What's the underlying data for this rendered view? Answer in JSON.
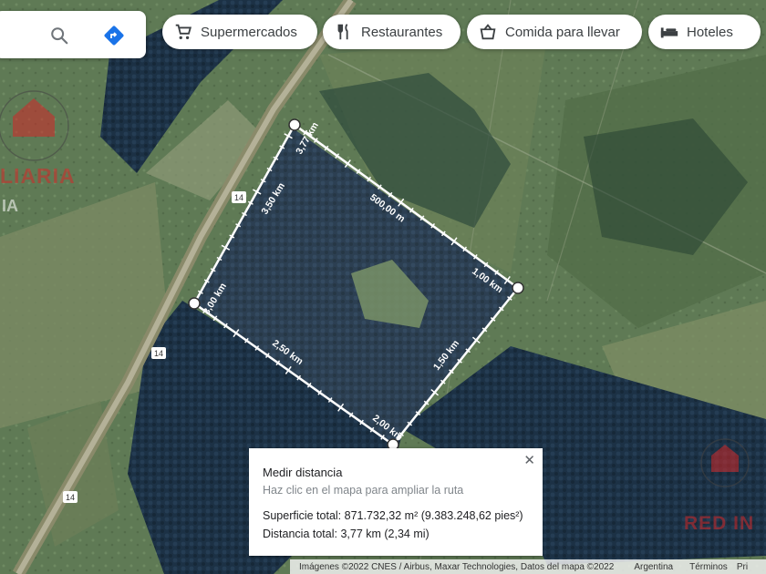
{
  "search": {
    "search_icon": "search-icon",
    "directions_icon": "directions-icon"
  },
  "chips": [
    {
      "label": "Supermercados",
      "icon": "cart-icon"
    },
    {
      "label": "Restaurantes",
      "icon": "fork-knife-icon"
    },
    {
      "label": "Comida para llevar",
      "icon": "takeout-icon"
    },
    {
      "label": "Hoteles",
      "icon": "bed-icon"
    }
  ],
  "map": {
    "road_labels": [
      "14",
      "14",
      "14"
    ],
    "measure_labels": [
      "3,77 km",
      "3,50 km",
      "500,00 m",
      "1,00 km",
      "3,00 km",
      "2,50 km",
      "1,50 km",
      "2,00 km"
    ]
  },
  "panel": {
    "title": "Medir distancia",
    "hint": "Haz clic en el mapa para ampliar la ruta",
    "area": "Superficie total: 871.732,32 m² (9.383.248,62 pies²)",
    "distance": "Distancia total: 3,77 km (2,34 mi)",
    "close_icon": "close-icon"
  },
  "attribution": {
    "sources": "Imágenes ©2022 CNES / Airbus, Maxar Technologies, Datos del mapa ©2022",
    "country": "Argentina",
    "terms": "Términos",
    "privacy": "Pri"
  },
  "watermark": {
    "left_text": "LIARIA",
    "left_sub": "IA",
    "right_text": "RED IN"
  },
  "colors": {
    "measure_line": "#ffffff",
    "watermark": "#d22828",
    "road": "#8a8a6a"
  }
}
